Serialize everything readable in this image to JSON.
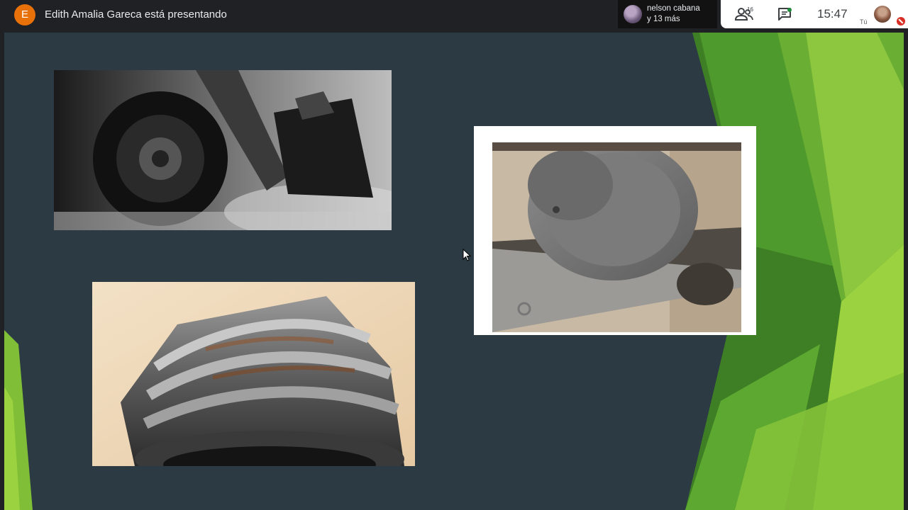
{
  "topbar": {
    "presenter_initial": "E",
    "presenter_text": "Edith Amalia Gareca está presentando",
    "participant_name": "nelson cabana",
    "participant_more": "y 13 más",
    "people_count": "16",
    "time": "15:47",
    "self_label": "Tú"
  },
  "colors": {
    "slide_background": "#2b3a43",
    "accent_green": "#8dc63f",
    "dark_green": "#4f8f2a",
    "presenter_avatar": "#e8710a",
    "mic_off": "#d93025"
  },
  "icons": {
    "people": "people-icon",
    "chat": "chat-icon",
    "mic": "mic-off-icon",
    "cursor": "mouse-cursor-icon"
  },
  "slide": {
    "images": [
      "excavator-wheel-photo",
      "gear-wear-photo",
      "rail-wheel-photo"
    ]
  }
}
